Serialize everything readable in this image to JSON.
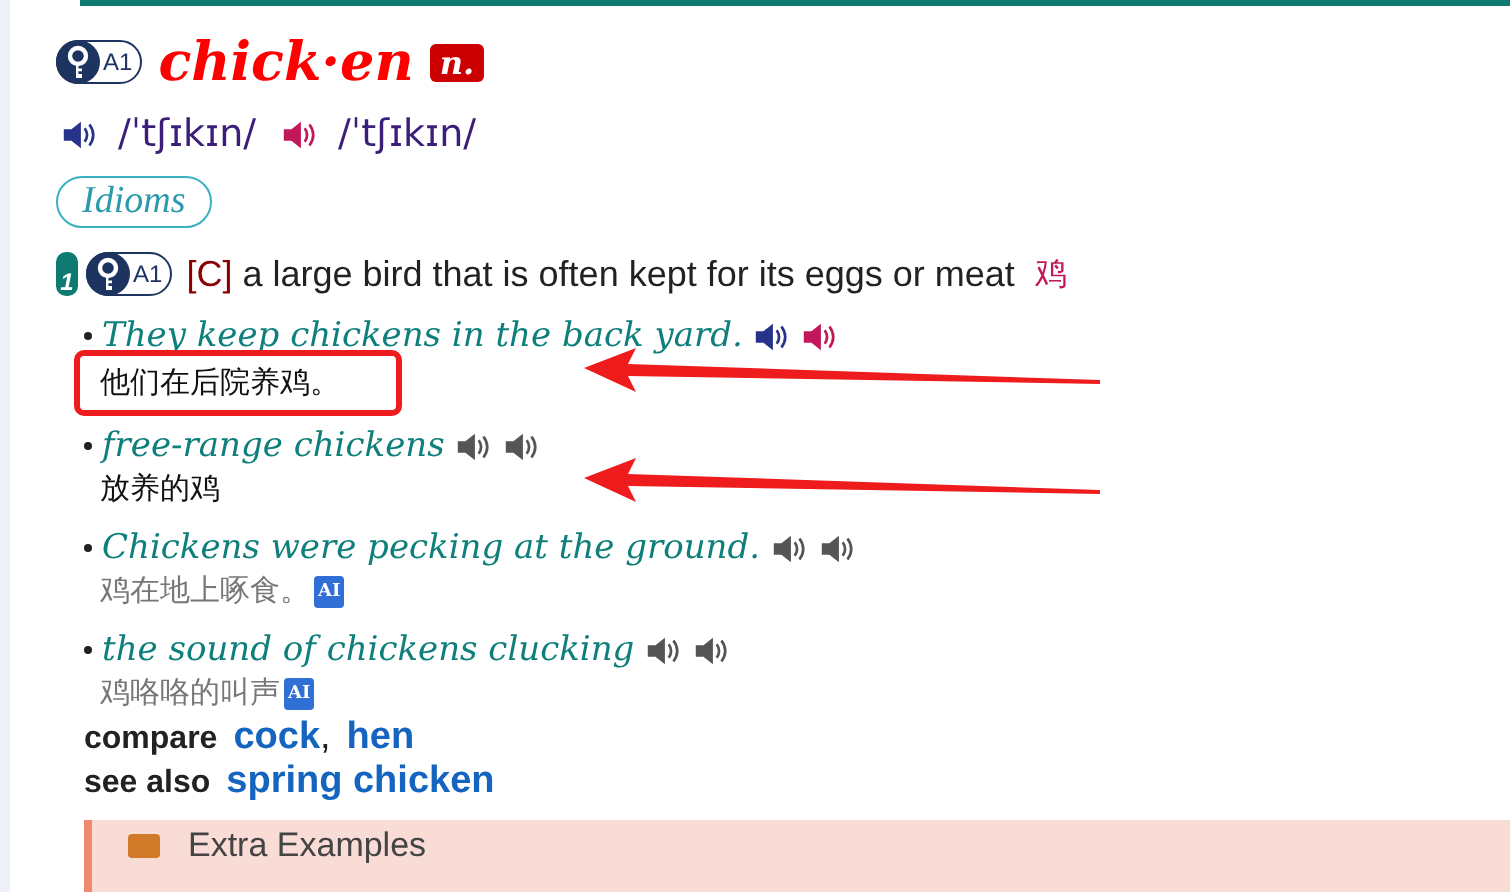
{
  "entry": {
    "level": "A1",
    "headword": "chick·en",
    "pos": "n."
  },
  "pronunciations": [
    {
      "kind": "british",
      "ipa": "/ˈtʃɪkɪn/"
    },
    {
      "kind": "american",
      "ipa": "/ˈtʃɪkɪn/"
    }
  ],
  "idioms_button": "Idioms",
  "sense": {
    "number": "1",
    "level": "A1",
    "grammar": "[C]",
    "definition": "a large bird that is often kept for its eggs or meat",
    "translation": "鸡"
  },
  "examples": [
    {
      "text": "They keep chickens in the back yard.",
      "audio_colored": true,
      "translation": "他们在后院养鸡。",
      "translation_muted": false,
      "highlighted": true,
      "arrow": true
    },
    {
      "text": "free-range chickens",
      "audio_colored": false,
      "translation": "放养的鸡",
      "translation_muted": false,
      "highlighted": false,
      "arrow": true
    },
    {
      "text": "Chickens were pecking at the ground.",
      "audio_colored": false,
      "translation": "鸡在地上啄食。",
      "translation_muted": true,
      "ai_badge": "AI",
      "highlighted": false,
      "arrow": false
    },
    {
      "text": "the sound of chickens clucking",
      "audio_colored": false,
      "translation": "鸡咯咯的叫声",
      "translation_muted": true,
      "ai_badge": "AI",
      "highlighted": false,
      "arrow": false
    }
  ],
  "xrefs": [
    {
      "label": "compare",
      "links": [
        "cock",
        "hen"
      ],
      "separator": ","
    },
    {
      "label": "see also",
      "links": [
        "spring chicken"
      ]
    }
  ],
  "extra_examples": {
    "title": "Extra Examples",
    "expanded": false
  }
}
